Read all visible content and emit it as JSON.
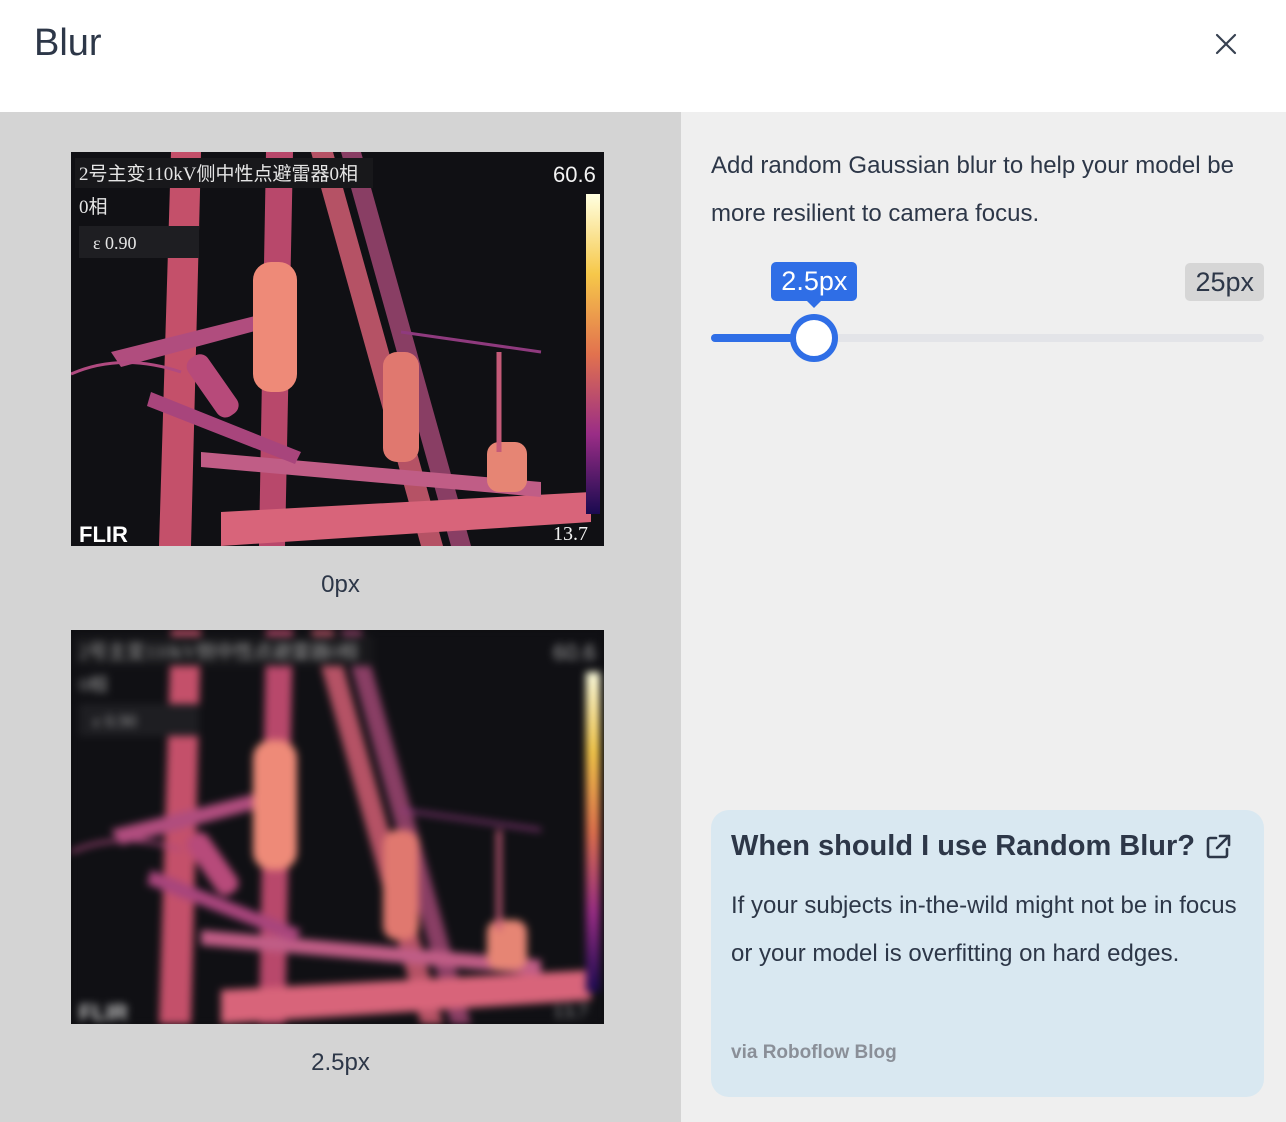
{
  "dialog": {
    "title": "Blur",
    "close_icon": "close-icon"
  },
  "previews": [
    {
      "caption": "0px",
      "overlay": {
        "line1": "2号主变110kV侧中性点避雷器0相",
        "line2": "0相",
        "emissivity": "ε  0.90",
        "temp_max": "60.6",
        "temp_min": "13.7",
        "logo": "FLIR"
      }
    },
    {
      "caption": "2.5px",
      "overlay": {
        "line1": "2号主变110kV侧中性点避雷器0相",
        "line2": "0相",
        "emissivity": "ε  0.90",
        "temp_max": "60.6",
        "temp_min": "13.7",
        "logo": "FLIR"
      }
    }
  ],
  "settings": {
    "description": "Add random Gaussian blur to help your model be more resilient to camera focus.",
    "slider": {
      "value_label": "2.5px",
      "max_label": "25px",
      "value": 2.5,
      "min": 0,
      "max": 25,
      "accent_color": "#2f6ee6"
    }
  },
  "info_card": {
    "title": "When should I use Random Blur?",
    "link_icon": "external-link-icon",
    "body": "If your subjects in-the-wild might not be in focus or your model is overfitting on hard edges.",
    "source": "via Roboflow Blog"
  }
}
